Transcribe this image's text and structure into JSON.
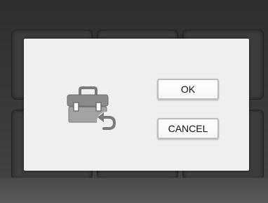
{
  "dialog": {
    "icon": "toolbox-restore-icon",
    "ok_label": "OK",
    "cancel_label": "CANCEL"
  },
  "colors": {
    "dialog_background": "#efefef",
    "button_border": "#bdbdbd",
    "icon_gray": "#7a7a7a",
    "screen_background": "#2e2e2e"
  }
}
